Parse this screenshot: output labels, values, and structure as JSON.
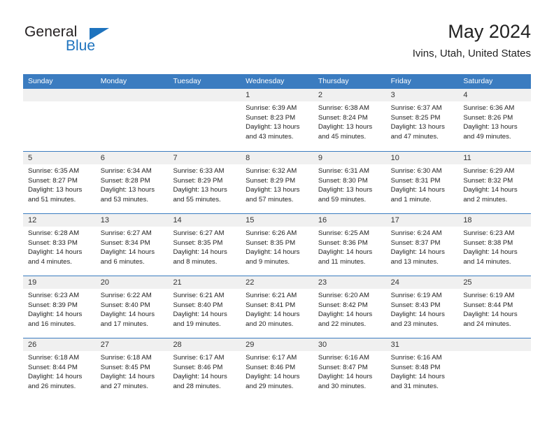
{
  "brand": {
    "name_top": "General",
    "name_bottom": "Blue",
    "accent_color": "#1e73be",
    "triangle_icon": "brand-triangle-icon"
  },
  "header": {
    "title": "May 2024",
    "subtitle": "Ivins, Utah, United States"
  },
  "theme": {
    "header_bar_color": "#3b7cc0",
    "date_band_color": "#f0f0f0",
    "row_divider_color": "#3b7cc0"
  },
  "weekdays": [
    "Sunday",
    "Monday",
    "Tuesday",
    "Wednesday",
    "Thursday",
    "Friday",
    "Saturday"
  ],
  "weeks": [
    [
      {
        "day": "",
        "blank": true
      },
      {
        "day": "",
        "blank": true
      },
      {
        "day": "",
        "blank": true
      },
      {
        "day": "1",
        "sunrise": "Sunrise: 6:39 AM",
        "sunset": "Sunset: 8:23 PM",
        "daylight_a": "Daylight: 13 hours",
        "daylight_b": "and 43 minutes."
      },
      {
        "day": "2",
        "sunrise": "Sunrise: 6:38 AM",
        "sunset": "Sunset: 8:24 PM",
        "daylight_a": "Daylight: 13 hours",
        "daylight_b": "and 45 minutes."
      },
      {
        "day": "3",
        "sunrise": "Sunrise: 6:37 AM",
        "sunset": "Sunset: 8:25 PM",
        "daylight_a": "Daylight: 13 hours",
        "daylight_b": "and 47 minutes."
      },
      {
        "day": "4",
        "sunrise": "Sunrise: 6:36 AM",
        "sunset": "Sunset: 8:26 PM",
        "daylight_a": "Daylight: 13 hours",
        "daylight_b": "and 49 minutes."
      }
    ],
    [
      {
        "day": "5",
        "sunrise": "Sunrise: 6:35 AM",
        "sunset": "Sunset: 8:27 PM",
        "daylight_a": "Daylight: 13 hours",
        "daylight_b": "and 51 minutes."
      },
      {
        "day": "6",
        "sunrise": "Sunrise: 6:34 AM",
        "sunset": "Sunset: 8:28 PM",
        "daylight_a": "Daylight: 13 hours",
        "daylight_b": "and 53 minutes."
      },
      {
        "day": "7",
        "sunrise": "Sunrise: 6:33 AM",
        "sunset": "Sunset: 8:29 PM",
        "daylight_a": "Daylight: 13 hours",
        "daylight_b": "and 55 minutes."
      },
      {
        "day": "8",
        "sunrise": "Sunrise: 6:32 AM",
        "sunset": "Sunset: 8:29 PM",
        "daylight_a": "Daylight: 13 hours",
        "daylight_b": "and 57 minutes."
      },
      {
        "day": "9",
        "sunrise": "Sunrise: 6:31 AM",
        "sunset": "Sunset: 8:30 PM",
        "daylight_a": "Daylight: 13 hours",
        "daylight_b": "and 59 minutes."
      },
      {
        "day": "10",
        "sunrise": "Sunrise: 6:30 AM",
        "sunset": "Sunset: 8:31 PM",
        "daylight_a": "Daylight: 14 hours",
        "daylight_b": "and 1 minute."
      },
      {
        "day": "11",
        "sunrise": "Sunrise: 6:29 AM",
        "sunset": "Sunset: 8:32 PM",
        "daylight_a": "Daylight: 14 hours",
        "daylight_b": "and 2 minutes."
      }
    ],
    [
      {
        "day": "12",
        "sunrise": "Sunrise: 6:28 AM",
        "sunset": "Sunset: 8:33 PM",
        "daylight_a": "Daylight: 14 hours",
        "daylight_b": "and 4 minutes."
      },
      {
        "day": "13",
        "sunrise": "Sunrise: 6:27 AM",
        "sunset": "Sunset: 8:34 PM",
        "daylight_a": "Daylight: 14 hours",
        "daylight_b": "and 6 minutes."
      },
      {
        "day": "14",
        "sunrise": "Sunrise: 6:27 AM",
        "sunset": "Sunset: 8:35 PM",
        "daylight_a": "Daylight: 14 hours",
        "daylight_b": "and 8 minutes."
      },
      {
        "day": "15",
        "sunrise": "Sunrise: 6:26 AM",
        "sunset": "Sunset: 8:35 PM",
        "daylight_a": "Daylight: 14 hours",
        "daylight_b": "and 9 minutes."
      },
      {
        "day": "16",
        "sunrise": "Sunrise: 6:25 AM",
        "sunset": "Sunset: 8:36 PM",
        "daylight_a": "Daylight: 14 hours",
        "daylight_b": "and 11 minutes."
      },
      {
        "day": "17",
        "sunrise": "Sunrise: 6:24 AM",
        "sunset": "Sunset: 8:37 PM",
        "daylight_a": "Daylight: 14 hours",
        "daylight_b": "and 13 minutes."
      },
      {
        "day": "18",
        "sunrise": "Sunrise: 6:23 AM",
        "sunset": "Sunset: 8:38 PM",
        "daylight_a": "Daylight: 14 hours",
        "daylight_b": "and 14 minutes."
      }
    ],
    [
      {
        "day": "19",
        "sunrise": "Sunrise: 6:23 AM",
        "sunset": "Sunset: 8:39 PM",
        "daylight_a": "Daylight: 14 hours",
        "daylight_b": "and 16 minutes."
      },
      {
        "day": "20",
        "sunrise": "Sunrise: 6:22 AM",
        "sunset": "Sunset: 8:40 PM",
        "daylight_a": "Daylight: 14 hours",
        "daylight_b": "and 17 minutes."
      },
      {
        "day": "21",
        "sunrise": "Sunrise: 6:21 AM",
        "sunset": "Sunset: 8:40 PM",
        "daylight_a": "Daylight: 14 hours",
        "daylight_b": "and 19 minutes."
      },
      {
        "day": "22",
        "sunrise": "Sunrise: 6:21 AM",
        "sunset": "Sunset: 8:41 PM",
        "daylight_a": "Daylight: 14 hours",
        "daylight_b": "and 20 minutes."
      },
      {
        "day": "23",
        "sunrise": "Sunrise: 6:20 AM",
        "sunset": "Sunset: 8:42 PM",
        "daylight_a": "Daylight: 14 hours",
        "daylight_b": "and 22 minutes."
      },
      {
        "day": "24",
        "sunrise": "Sunrise: 6:19 AM",
        "sunset": "Sunset: 8:43 PM",
        "daylight_a": "Daylight: 14 hours",
        "daylight_b": "and 23 minutes."
      },
      {
        "day": "25",
        "sunrise": "Sunrise: 6:19 AM",
        "sunset": "Sunset: 8:44 PM",
        "daylight_a": "Daylight: 14 hours",
        "daylight_b": "and 24 minutes."
      }
    ],
    [
      {
        "day": "26",
        "sunrise": "Sunrise: 6:18 AM",
        "sunset": "Sunset: 8:44 PM",
        "daylight_a": "Daylight: 14 hours",
        "daylight_b": "and 26 minutes."
      },
      {
        "day": "27",
        "sunrise": "Sunrise: 6:18 AM",
        "sunset": "Sunset: 8:45 PM",
        "daylight_a": "Daylight: 14 hours",
        "daylight_b": "and 27 minutes."
      },
      {
        "day": "28",
        "sunrise": "Sunrise: 6:17 AM",
        "sunset": "Sunset: 8:46 PM",
        "daylight_a": "Daylight: 14 hours",
        "daylight_b": "and 28 minutes."
      },
      {
        "day": "29",
        "sunrise": "Sunrise: 6:17 AM",
        "sunset": "Sunset: 8:46 PM",
        "daylight_a": "Daylight: 14 hours",
        "daylight_b": "and 29 minutes."
      },
      {
        "day": "30",
        "sunrise": "Sunrise: 6:16 AM",
        "sunset": "Sunset: 8:47 PM",
        "daylight_a": "Daylight: 14 hours",
        "daylight_b": "and 30 minutes."
      },
      {
        "day": "31",
        "sunrise": "Sunrise: 6:16 AM",
        "sunset": "Sunset: 8:48 PM",
        "daylight_a": "Daylight: 14 hours",
        "daylight_b": "and 31 minutes."
      },
      {
        "day": "",
        "blank": true
      }
    ]
  ]
}
